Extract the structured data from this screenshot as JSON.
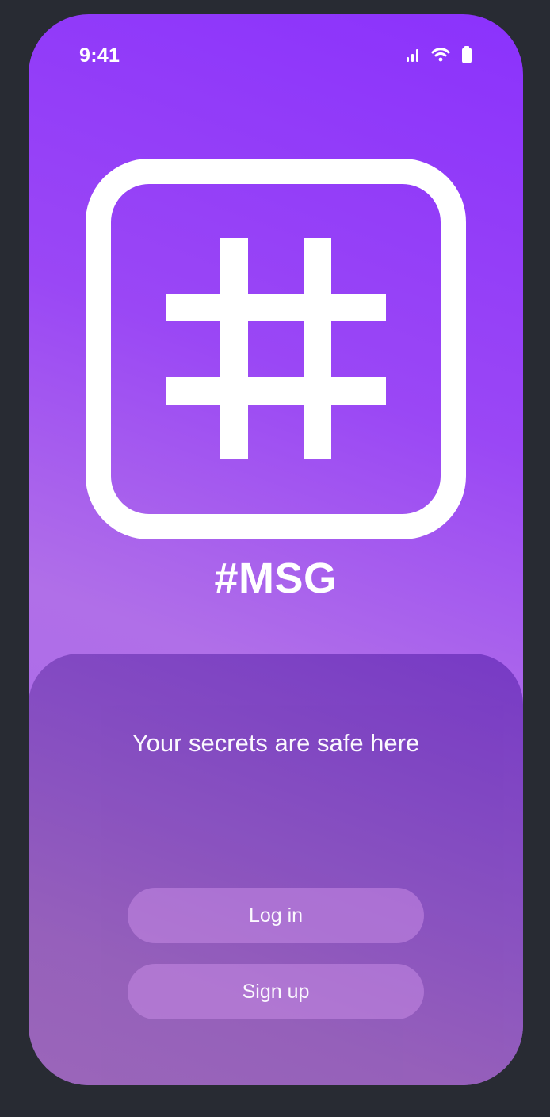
{
  "status_bar": {
    "time": "9:41",
    "icons": [
      "signal-icon",
      "wifi-icon",
      "battery-icon"
    ]
  },
  "logo": {
    "icon": "hashtag-icon",
    "color": "#ffffff"
  },
  "app": {
    "name": "#MSG",
    "tagline": "Your secrets are safe here"
  },
  "actions": {
    "login_label": "Log in",
    "signup_label": "Sign up"
  },
  "colors": {
    "background": "#282b33",
    "gradient_top": "#8b32fc",
    "gradient_bottom": "#a765e6",
    "sheet": "#8750bf",
    "button": "#c08ce6",
    "text": "#ffffff"
  }
}
